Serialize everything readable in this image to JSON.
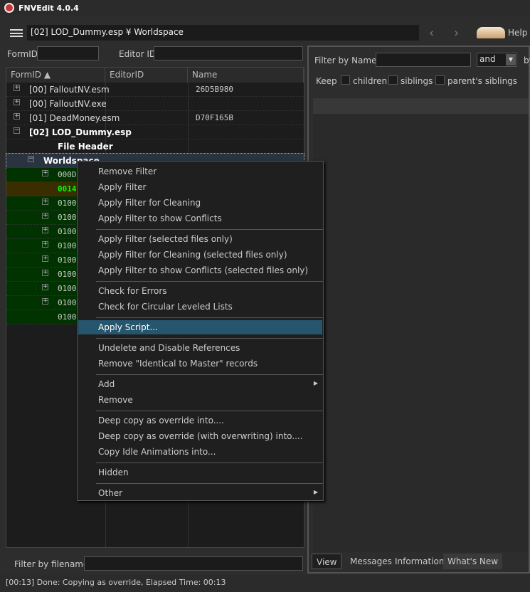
{
  "title": "FNVEdit 4.0.4",
  "toolbar": {
    "path": "[02] LOD_Dummy.esp ¥ Worldspace",
    "back": "‹",
    "forward": "›",
    "help": "Help"
  },
  "search": {
    "formid_label": "FormID",
    "editorid_label": "Editor ID"
  },
  "tree": {
    "columns": [
      "FormID",
      "EditorID",
      "Name"
    ],
    "rows": [
      {
        "label": "[00] FalloutNV.esm",
        "name": "26D5B980"
      },
      {
        "label": "[00] FalloutNV.exe",
        "name": ""
      },
      {
        "label": "[01] DeadMoney.esm",
        "name": "D70F165B"
      },
      {
        "label": "[02] LOD_Dummy.esp",
        "name": ""
      },
      {
        "label": "File Header",
        "name": ""
      },
      {
        "label": "Worldspace",
        "name": ""
      }
    ],
    "children": [
      "000D",
      "0014",
      "0100",
      "0100",
      "0100",
      "0100",
      "0100",
      "0100",
      "0100",
      "0100",
      "0100"
    ]
  },
  "filter_filename_label": "Filter by filename:",
  "right": {
    "filter_name_label": "Filter by Name:",
    "op": "and",
    "by": "by",
    "keep": "Keep",
    "children": "children",
    "siblings": "siblings",
    "parents": "parent's siblings",
    "tabs": [
      "View",
      "Messages",
      "Information",
      "What's New"
    ]
  },
  "menu": [
    "Remove Filter",
    "Apply Filter",
    "Apply Filter for Cleaning",
    "Apply Filter to show Conflicts",
    "-",
    "Apply Filter (selected files only)",
    "Apply Filter for Cleaning (selected files only)",
    "Apply Filter to show Conflicts (selected files only)",
    "-",
    "Check for Errors",
    "Check for Circular Leveled Lists",
    "-",
    "Apply Script...",
    "-",
    "Undelete and Disable References",
    "Remove \"Identical to Master\" records",
    "-",
    "Add",
    "Remove",
    "-",
    "Deep copy as override into....",
    "Deep copy as override (with overwriting) into....",
    "Copy Idle Animations into...",
    "-",
    "Hidden",
    "-",
    "Other"
  ],
  "status": "[00:13] Done: Copying as override, Elapsed Time: 00:13"
}
